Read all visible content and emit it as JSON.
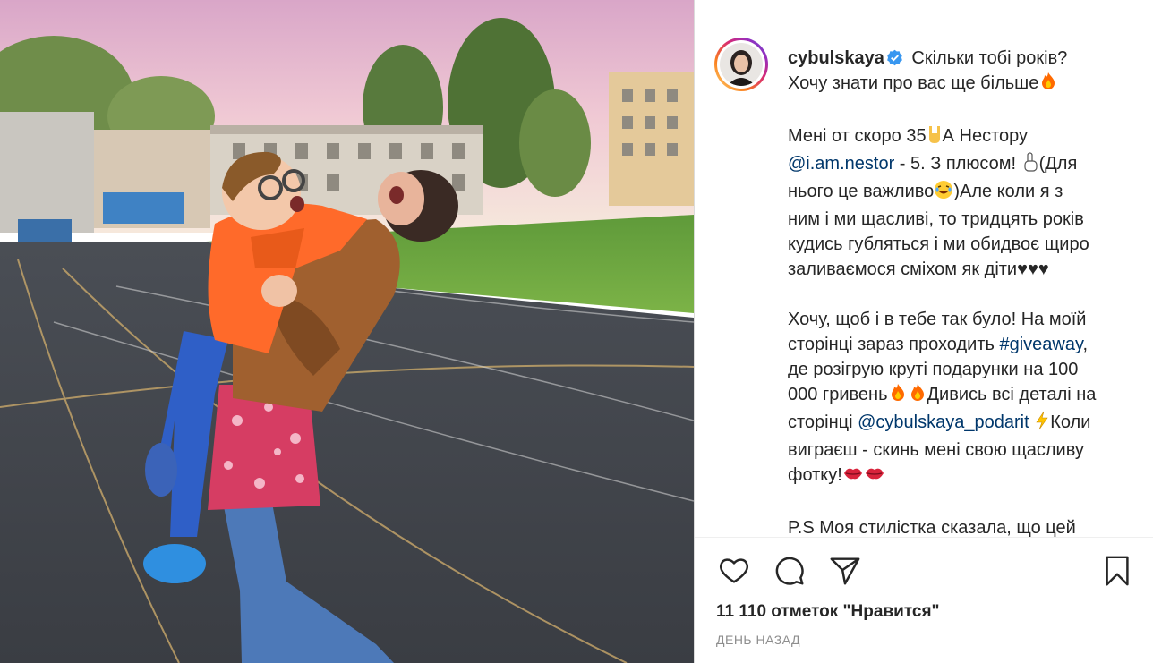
{
  "post": {
    "photo": {
      "kind": "photo",
      "subject": "mother-and-son-laughing-on-running-track"
    },
    "author": {
      "username": "cybulskaya",
      "verified": true
    },
    "caption": {
      "line1": "Скільки тобі років?",
      "line2": "Хочу знати про вас ще більше",
      "p2_a": "Мені от скоро 35",
      "p2_b": "А Нестору",
      "mention1": "@i.am.nestor",
      "p2_c": " - 5. З плюсом! ",
      "p2_d": "(Для",
      "p2_e": "нього це важливо",
      "p2_f": ")Але коли я з",
      "p2_g": "ним і ми щасливі, то тридцять років",
      "p2_h": "кудись губляться і ми обидвоє щиро",
      "p2_i": "заливаємося сміхом як діти",
      "p2_hearts": "♥♥♥",
      "p3_a": "Хочу, щоб і в тебе так було! На моїй",
      "p3_b": "сторінці зараз проходить ",
      "hashtag": "#giveaway",
      "p3_c": ",",
      "p3_d": "де розігрую круті подарунки на 100",
      "p3_e": "000 гривень",
      "p3_f": "Дивись всі деталі на",
      "p3_g": "сторінці ",
      "mention2": "@cybulskaya_podarit",
      "p3_h": "Коли",
      "p3_i": "виграєш - скинь мені свою щасливу",
      "p3_j": "фотку!",
      "p4_a": "P.S Моя стилістка сказала, що цей"
    },
    "actions": {
      "like": "heart-icon",
      "comment": "comment-icon",
      "share": "share-icon",
      "save": "bookmark-icon"
    },
    "likes_text": "11 110 отметок \"Нравится\"",
    "timestamp": "ДЕНЬ НАЗАД"
  },
  "colors": {
    "text": "#262626",
    "link": "#00376b",
    "muted": "#8e8e8e",
    "verified": "#3897f0",
    "border": "#dbdbdb"
  }
}
